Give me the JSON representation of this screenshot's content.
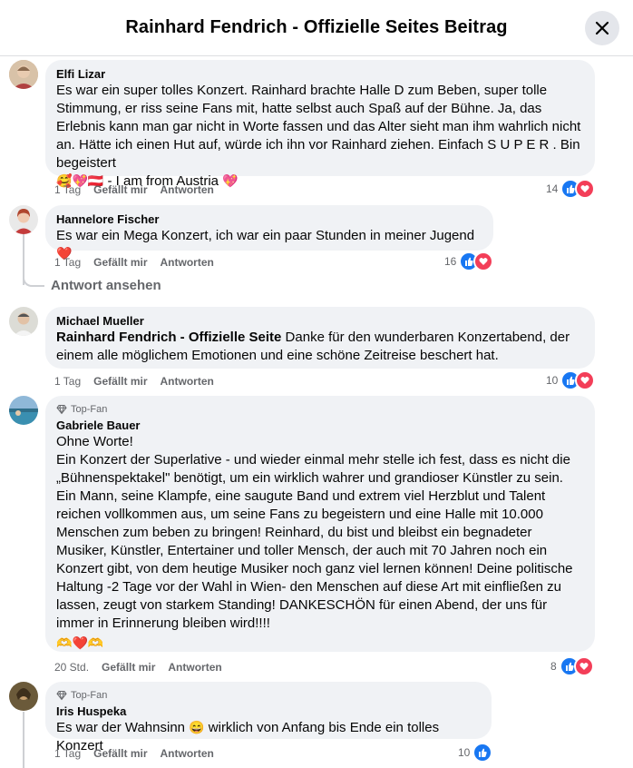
{
  "header": {
    "title": "Rainhard Fendrich - Offizielle Seites Beitrag"
  },
  "colors": {
    "accent": "#1877f2",
    "love": "#f33e58",
    "bubble": "#f0f2f5"
  },
  "comments": [
    {
      "author": "Elfi Lizar",
      "text": "Es war ein super tolles Konzert. Rainhard brachte Halle D zum Beben, super tolle Stimmung, er riss seine Fans mit, hatte selbst auch Spaß auf der Bühne. Ja, das Erlebnis kann man gar nicht in Worte fassen und das Alter sieht man ihm wahrlich nicht an. Hätte ich einen Hut auf, würde ich ihn vor Rainhard ziehen. Einfach S U P E R . Bin begeistert",
      "text_tail": " - I am from Austria ",
      "time": "1 Tag",
      "like_label": "Gefällt mir",
      "reply_label": "Antworten",
      "reaction_count": "14"
    },
    {
      "author": "Hannelore Fischer",
      "text": "Es war ein Mega Konzert, ich war ein paar Stunden in meiner Jugend ",
      "time": "1 Tag",
      "like_label": "Gefällt mir",
      "reply_label": "Antworten",
      "reaction_count": "16",
      "view_replies": "Antwort ansehen"
    },
    {
      "author": "Michael Mueller",
      "mention": "Rainhard Fendrich - Offizielle Seite",
      "text": " Danke für den wunderbaren Konzertabend, der einem alle möglichem Emotionen und eine schöne Zeitreise beschert hat.",
      "time": "1 Tag",
      "like_label": "Gefällt mir",
      "reply_label": "Antworten",
      "reaction_count": "10"
    },
    {
      "badge": "Top-Fan",
      "author": "Gabriele Bauer",
      "line1": "Ohne Worte!",
      "text": "Ein Konzert der Superlative - und wieder einmal mehr stelle ich fest, dass es nicht die „Bühnenspektakel\" benötigt, um ein wirklich wahrer und grandioser Künstler zu sein. Ein Mann, seine Klampfe, eine saugute Band und extrem viel Herzblut und Talent reichen vollkommen aus, um seine Fans zu begeistern und eine Halle mit 10.000 Menschen zum beben zu bringen! Reinhard, du bist und bleibst ein begnadeter Musiker, Künstler, Entertainer und toller Mensch, der auch mit 70 Jahren noch ein Konzert gibt, von dem heutige Musiker noch ganz viel lernen können! Deine politische Haltung -2 Tage vor der Wahl in Wien- den Menschen auf diese Art mit einfließen zu lassen, zeugt von starkem Standing! DANKESCHÖN für einen Abend, der uns für immer in Erinnerung bleiben wird!!!!",
      "time": "20 Std.",
      "like_label": "Gefällt mir",
      "reply_label": "Antworten",
      "reaction_count": "8"
    },
    {
      "badge": "Top-Fan",
      "author": "Iris Huspeka",
      "text": "Es war der Wahnsinn ",
      "text_tail": " wirklich von Anfang bis Ende ein tolles Konzert",
      "time": "1 Tag",
      "like_label": "Gefällt mir",
      "reply_label": "Antworten",
      "reaction_count": "10"
    }
  ]
}
